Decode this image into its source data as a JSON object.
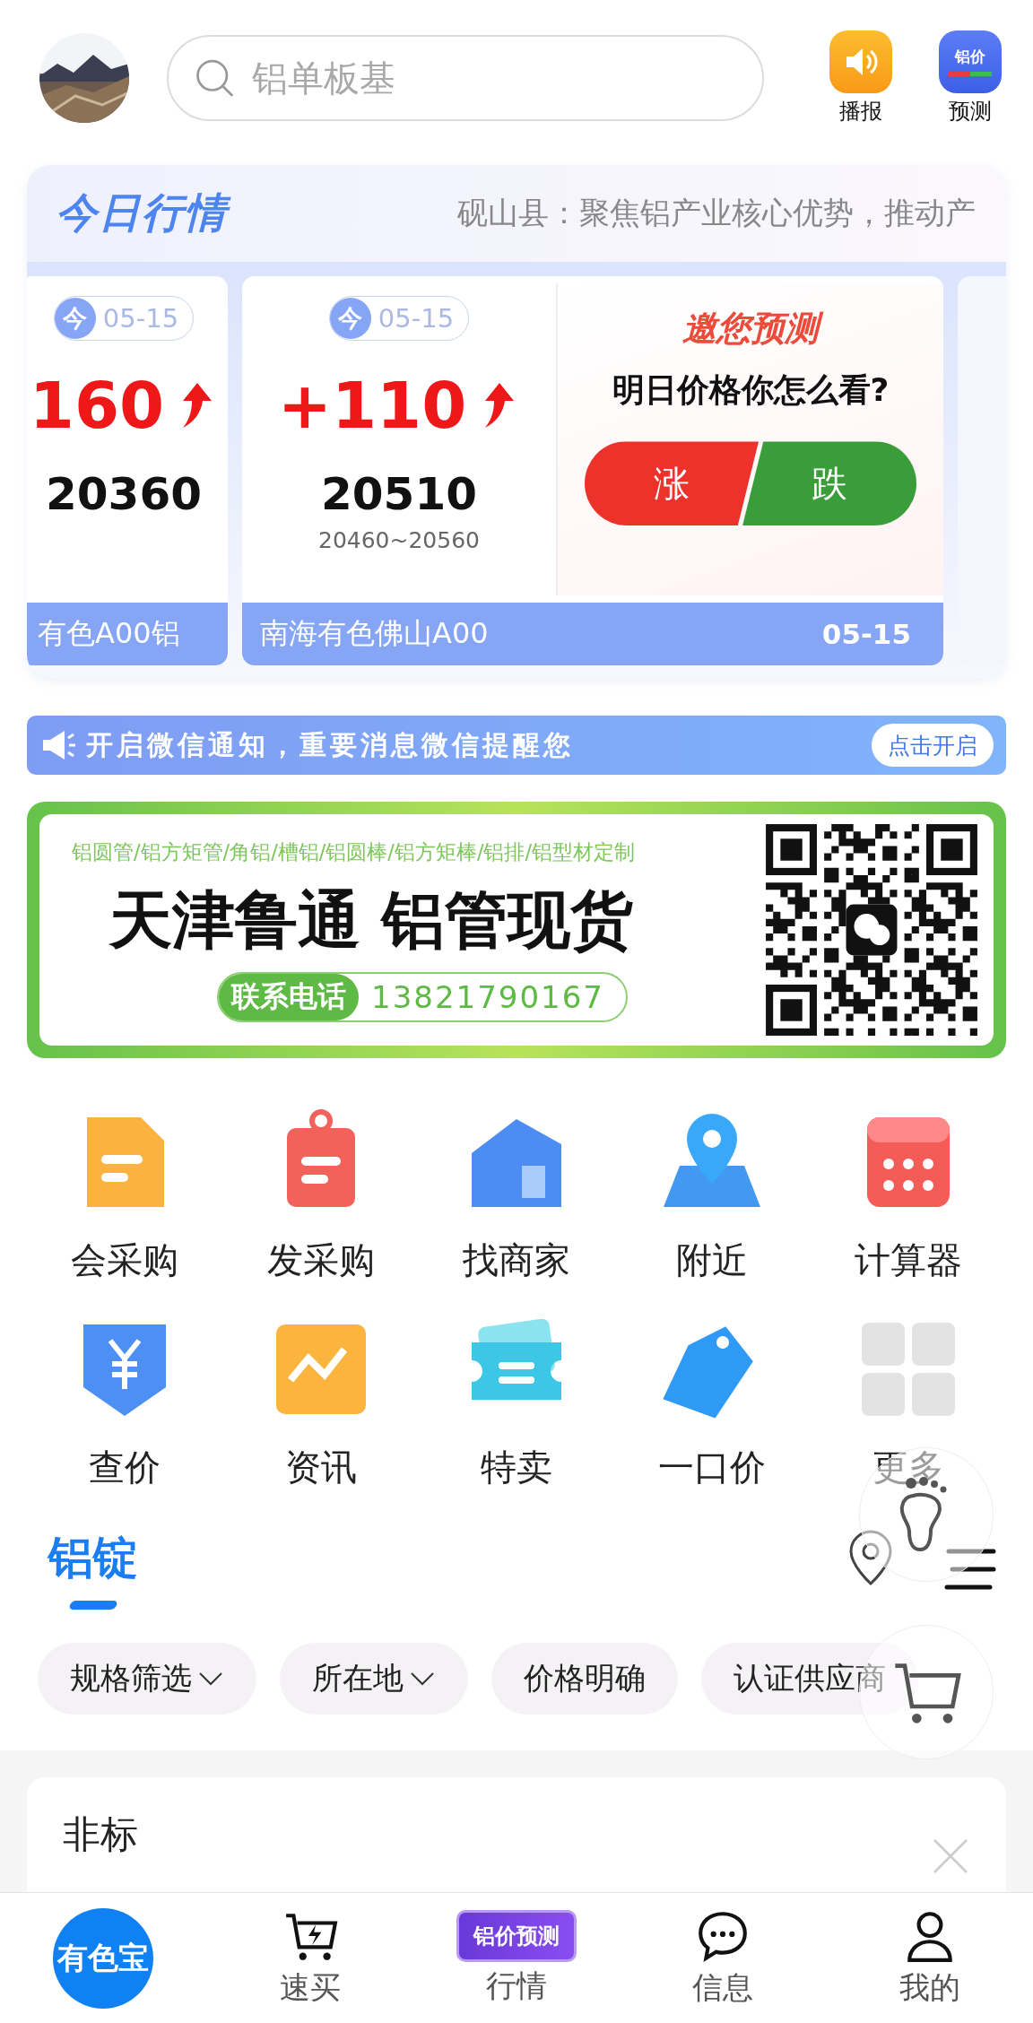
{
  "header": {
    "search": {
      "placeholder": "铝单板基"
    },
    "actions": [
      {
        "label": "播报",
        "kind": "speaker"
      },
      {
        "label": "预测",
        "kind": "forecast",
        "badge": "铝价"
      }
    ]
  },
  "market": {
    "title": "今日行情",
    "ticker": "砚山县：聚焦铝产业核心优势，推动产",
    "quotes": [
      {
        "tag": "今",
        "date": "05-15",
        "change": "160",
        "price": "20360",
        "source": "有色A00铝"
      },
      {
        "tag": "今",
        "date": "05-15",
        "change": "+110",
        "price": "20510",
        "range": "20460~20560",
        "source": "南海有色佛山A00",
        "footer_date": "05-15"
      }
    ],
    "predict": {
      "title": "邀您预测",
      "question": "明日价格你怎么看?",
      "up": "涨",
      "down": "跌"
    }
  },
  "notice": {
    "text": "开启微信通知，重要消息微信提醒您",
    "button": "点击开启"
  },
  "ad": {
    "tagline": "铝圆管/铝方矩管/角铝/槽铝/铝圆棒/铝方矩棒/铝排/铝型材定制",
    "headline": "天津鲁通 铝管现货",
    "phone_label": "联系电话",
    "phone": "13821790167"
  },
  "services": [
    {
      "label": "会采购",
      "kind": "doc"
    },
    {
      "label": "发采购",
      "kind": "clipboard"
    },
    {
      "label": "找商家",
      "kind": "house"
    },
    {
      "label": "附近",
      "kind": "map"
    },
    {
      "label": "计算器",
      "kind": "calculator"
    },
    {
      "label": "查价",
      "kind": "yen"
    },
    {
      "label": "资讯",
      "kind": "chart"
    },
    {
      "label": "特卖",
      "kind": "ticket"
    },
    {
      "label": "一口价",
      "kind": "tag"
    },
    {
      "label": "更多",
      "kind": "grid"
    }
  ],
  "category_tabs": [
    {
      "label": "铝锭",
      "selected": true
    }
  ],
  "filters": [
    {
      "label": "规格筛选",
      "dropdown": true
    },
    {
      "label": "所在地",
      "dropdown": true
    },
    {
      "label": "价格明确",
      "dropdown": false
    },
    {
      "label": "认证供应商",
      "dropdown": false
    }
  ],
  "listing": {
    "title": "非标"
  },
  "nav": [
    {
      "label": "有色宝",
      "kind": "home"
    },
    {
      "label": "速买",
      "kind": "cart"
    },
    {
      "label": "行情",
      "kind": "market",
      "badge": "铝价预测"
    },
    {
      "label": "信息",
      "kind": "chat"
    },
    {
      "label": "我的",
      "kind": "user"
    }
  ]
}
